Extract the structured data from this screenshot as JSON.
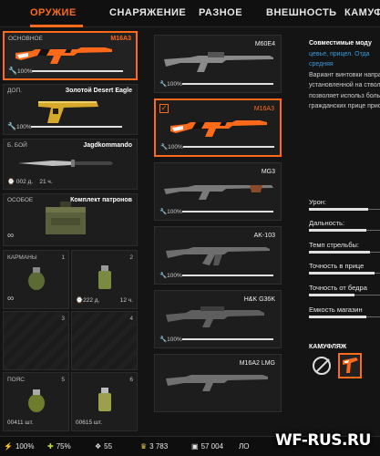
{
  "tabs": [
    {
      "label": "ОРУЖИЕ",
      "active": true
    },
    {
      "label": "СНАРЯЖЕНИЕ"
    },
    {
      "label": "РАЗНОЕ"
    },
    {
      "label": "ВНЕШНОСТЬ"
    },
    {
      "label": "КАМУФ"
    }
  ],
  "slots": {
    "primary": {
      "category": "ОСНОВНОЕ",
      "name": "M16A3",
      "durability": "100%",
      "durability_level": 1.0
    },
    "secondary": {
      "category": "ДОП.",
      "name": "Золотой Desert Eagle",
      "durability": "100%",
      "durability_level": 1.0
    },
    "melee": {
      "category": "Б. БОЙ",
      "name": "Jagdkommando",
      "duration": "002 д.",
      "hours": "21 ч."
    },
    "special": {
      "category": "ОСОБОЕ",
      "name": "Комплект патронов",
      "infinite": "∞"
    },
    "pockets": {
      "category": "КАРМАНЫ",
      "cell1_num": "1",
      "cell1_val": "∞",
      "cell2_num": "2",
      "cell2_val": "222 д.",
      "cell2_val2": "12 ч.",
      "cell3_num": "3",
      "cell4_num": "4"
    },
    "belt": {
      "category": "ПОЯС",
      "cell5_num": "5",
      "cell5_val": "00411 шт.",
      "cell6_num": "6",
      "cell6_val": "00615 шт."
    }
  },
  "weapon_list": [
    {
      "name": "M60E4",
      "durability": "100%",
      "durability_level": 1.0,
      "selected": false
    },
    {
      "name": "M16A3",
      "durability": "100%",
      "durability_level": 1.0,
      "selected": true
    },
    {
      "name": "MG3",
      "durability": "100%",
      "durability_level": 1.0,
      "selected": false
    },
    {
      "name": "AK-103",
      "durability": "100%",
      "durability_level": 1.0,
      "selected": false
    },
    {
      "name": "H&K G36K",
      "durability": "100%",
      "durability_level": 1.0,
      "selected": false
    },
    {
      "name": "M16A2 LMG",
      "durability": "",
      "selected": false
    }
  ],
  "details": {
    "compat_title": "Совместимые моду",
    "compat_highlight": "цевье, прицел. Отда",
    "compat_level": "средняя",
    "description": "Вариант винтовки направляющей Пик установленной на ствольной коробко позволяет использ большинство военн гражданских прице приспособлений.",
    "stats": [
      {
        "label": "Урон:",
        "value": 0.72
      },
      {
        "label": "Дальность:",
        "value": 0.7
      },
      {
        "label": "Темп стрельбы:",
        "value": 0.74
      },
      {
        "label": "Точность в прице",
        "value": 0.8
      },
      {
        "label": "Точность от бедра",
        "value": 0.55
      },
      {
        "label": "Емкость магазин",
        "value": 0.7
      }
    ],
    "camo_title": "КАМУФЛЯЖ"
  },
  "bottom_bar": {
    "item1": "100%",
    "item2": "75%",
    "item3": "55",
    "item4": "3 783",
    "item5": "57 004",
    "item6": "ЛО"
  },
  "watermark": "WF-RUS.RU",
  "colors": {
    "accent": "#ff6a1a",
    "background": "#141414",
    "highlight": "#3a9bdc"
  }
}
